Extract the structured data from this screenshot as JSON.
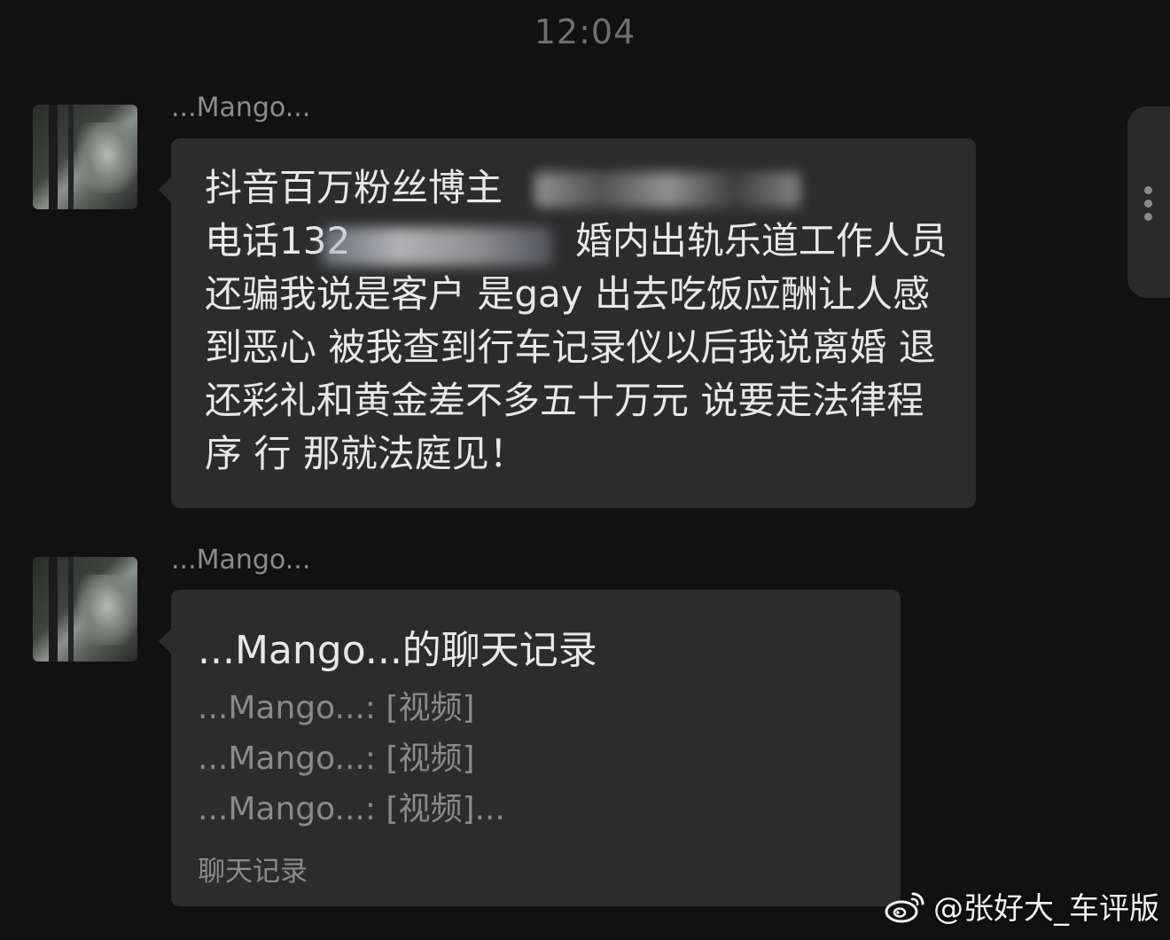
{
  "timestamp": "12:04",
  "messages": [
    {
      "sender": "...Mango...",
      "text": "抖音百万粉丝博主                     \n电话132                   婚内出轨乐道工作人员 还骗我说是客户 是gay 出去吃饭应酬让人感到恶心 被我查到行车记录仪以后我说离婚 退还彩礼和黄金差不多五十万元 说要走法律程序 行 那就法庭见！"
    },
    {
      "sender": "...Mango...",
      "record": {
        "title": "...Mango...的聊天记录",
        "lines": [
          "...Mango...: [视频]",
          "...Mango...: [视频]",
          "...Mango...: [视频]..."
        ],
        "footer": "聊天记录"
      }
    }
  ],
  "watermark": {
    "text": "@张好大_车评版",
    "icon": "weibo-logo-icon"
  },
  "side_handle": {
    "icon": "more-vertical-icon"
  },
  "colors": {
    "background": "#111111",
    "bubble": "#2c2c2c",
    "text_primary": "#e8e8e8",
    "text_secondary": "#8a8a8a"
  }
}
